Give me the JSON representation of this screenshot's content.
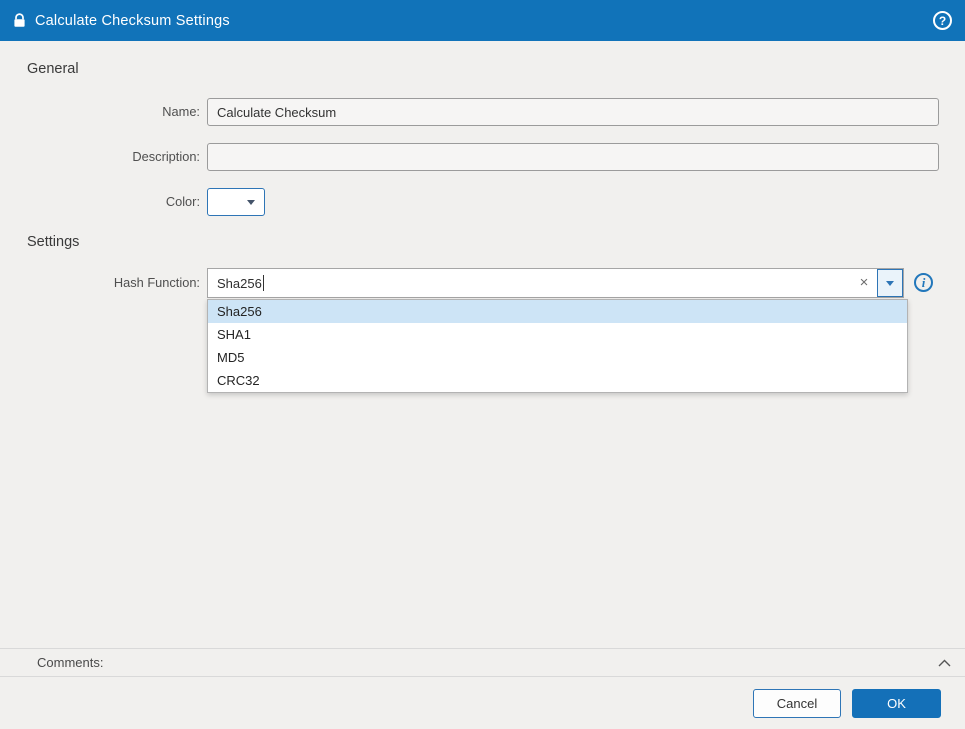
{
  "header": {
    "title": "Calculate Checksum Settings",
    "help_glyph": "?"
  },
  "general": {
    "heading": "General",
    "name_label": "Name:",
    "name_value": "Calculate Checksum",
    "description_label": "Description:",
    "description_value": "",
    "color_label": "Color:"
  },
  "settings": {
    "heading": "Settings",
    "hash_label": "Hash Function:",
    "hash_value": "Sha256",
    "clear_glyph": "×",
    "info_glyph": "i",
    "dropdown_options": [
      "Sha256",
      "SHA1",
      "MD5",
      "CRC32"
    ],
    "selected_option": "Sha256"
  },
  "comments": {
    "label": "Comments:"
  },
  "footer": {
    "cancel_label": "Cancel",
    "ok_label": "OK"
  },
  "colors": {
    "header_bg": "#1173b9",
    "accent": "#2e75b6",
    "ok_bg": "#1470b8",
    "highlight": "#cde4f6"
  }
}
